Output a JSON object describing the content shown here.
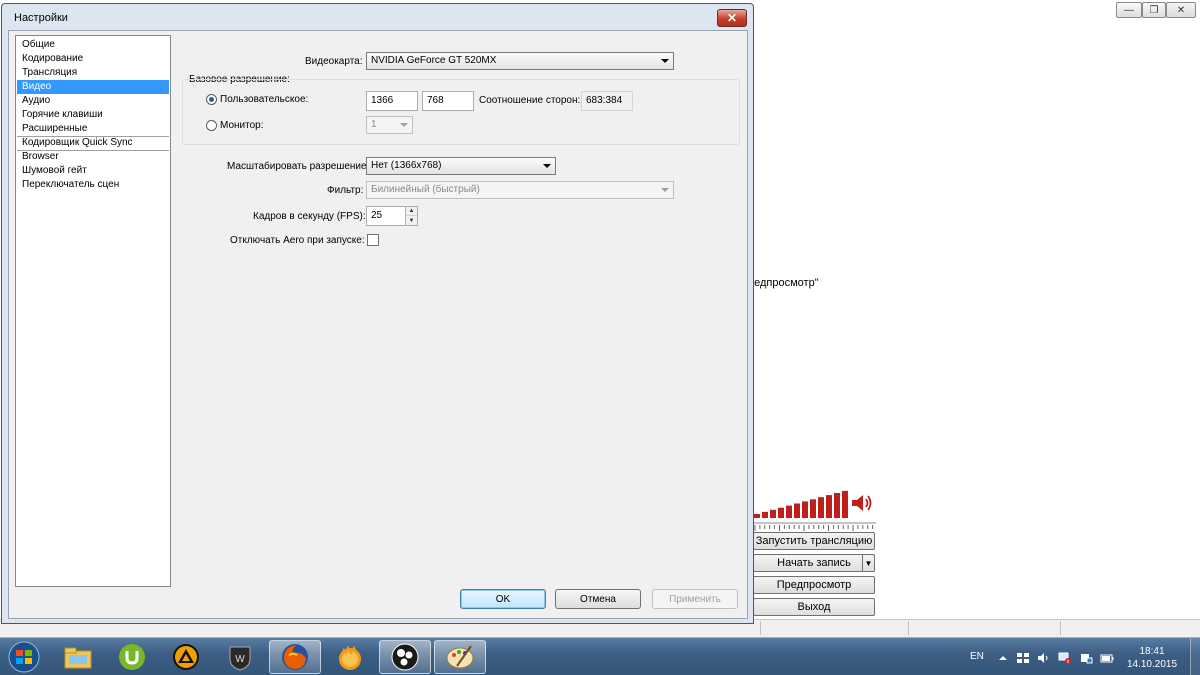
{
  "dialog": {
    "title": "Настройки",
    "close_label": "✕",
    "nav_items": [
      {
        "label": "Общие",
        "selected": false
      },
      {
        "label": "Кодирование",
        "selected": false
      },
      {
        "label": "Трансляция",
        "selected": false
      },
      {
        "label": "Видео",
        "selected": true
      },
      {
        "label": "Аудио",
        "selected": false
      },
      {
        "label": "Горячие клавиши",
        "selected": false
      },
      {
        "label": "Расширенные",
        "selected": false
      },
      {
        "label": "Кодировщик Quick Sync",
        "selected": false
      },
      {
        "label": "Browser",
        "selected": false
      },
      {
        "label": "Шумовой гейт",
        "selected": false
      },
      {
        "label": "Переключатель сцен",
        "selected": false
      }
    ],
    "video": {
      "gpu_label": "Видеокарта:",
      "gpu_value": "NVIDIA GeForce GT 520MX",
      "base_res_label": "Базовое разрешение:",
      "custom_label": "Пользовательское:",
      "custom_selected": true,
      "width": "1366",
      "height": "768",
      "aspect_label": "Соотношение сторон:",
      "aspect_value": "683:384",
      "monitor_label": "Монитор:",
      "monitor_value": "1",
      "scale_label": "Масштабировать разрешение:",
      "scale_value": "Нет  (1366x768)",
      "filter_label": "Фильтр:",
      "filter_value": "Билинейный (быстрый)",
      "fps_label": "Кадров в секунду (FPS):",
      "fps_value": "25",
      "aero_label": "Отключать Aero при запуске:",
      "aero_checked": false
    },
    "buttons": {
      "ok": "OK",
      "cancel": "Отмена",
      "apply": "Применить"
    }
  },
  "obs_main": {
    "preview_fragment": "редпросмотр\"",
    "start_stream": "Запустить трансляцию",
    "start_record": "Начать запись",
    "preview": "Предпросмотр",
    "exit": "Выход",
    "volume_color": "#c0201c"
  },
  "taskbar": {
    "apps": [
      "windows-explorer",
      "utorrent",
      "aimp",
      "world-of-tanks",
      "firefox",
      "hamster",
      "obs",
      "paint"
    ],
    "language": "EN",
    "time": "18:41",
    "date": "14.10.2015"
  }
}
